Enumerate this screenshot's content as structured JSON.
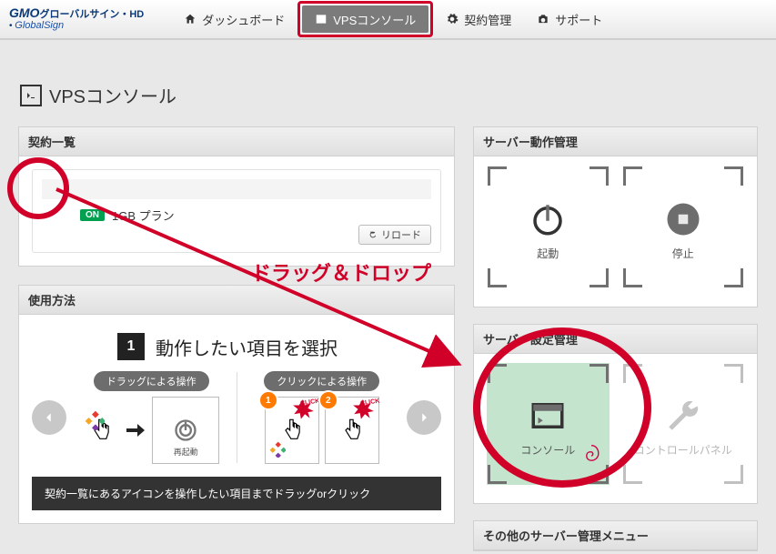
{
  "brand": {
    "line1": "GMO",
    "line2": "グローバルサイン・HD",
    "sub": "GlobalSign"
  },
  "nav": {
    "dashboard": "ダッシュボード",
    "vps": "VPSコンソール",
    "contract": "契約管理",
    "support": "サポート"
  },
  "page_title": "VPSコンソール",
  "contract_panel": {
    "title": "契約一覧",
    "on_badge": "ON",
    "plan": "1GB プラン",
    "reload": "リロード"
  },
  "usage_panel": {
    "title": "使用方法",
    "step_num": "1",
    "step_text": "動作したい項目を選択",
    "mode_drag": "ドラッグによる操作",
    "mode_click": "クリックによる操作",
    "mini_label": "再起動",
    "num1": "1",
    "num2": "2",
    "click_tag": "CLICK",
    "bar_text": "契約一覧にあるアイコンを操作したい項目までドラッグorクリック"
  },
  "server_ops": {
    "title": "サーバー動作管理",
    "start": "起動",
    "stop": "停止"
  },
  "server_cfg": {
    "title": "サーバー設定管理",
    "console": "コンソール",
    "cpanel": "コントロールパネル"
  },
  "other_menu": {
    "title": "その他のサーバー管理メニュー"
  },
  "annotation": {
    "dragdrop": "ドラッグ＆ドロップ"
  }
}
